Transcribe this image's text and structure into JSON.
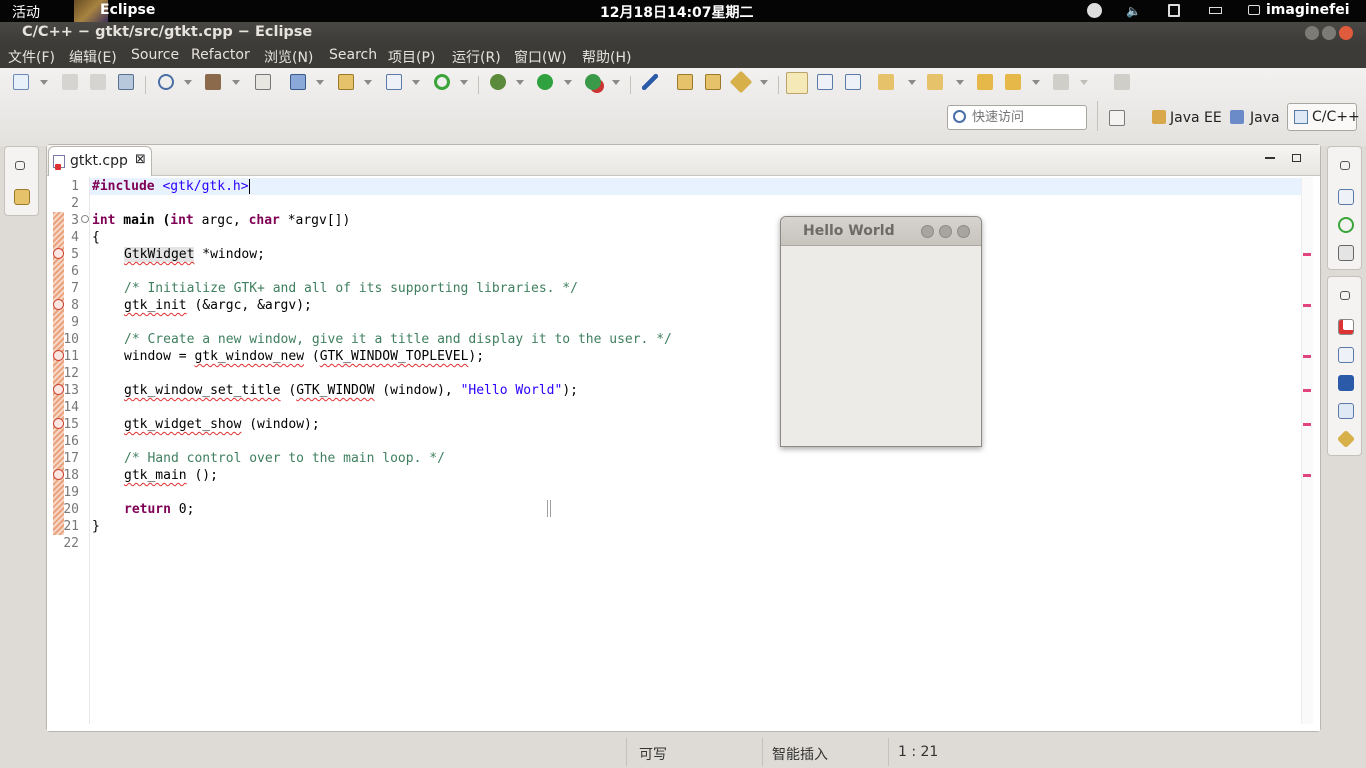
{
  "topbar": {
    "activities": "活动",
    "app_name": "Eclipse",
    "clock": "12月18日14:07星期二",
    "user": "imaginefei"
  },
  "window": {
    "title": "C/C++ − gtkt/src/gtkt.cpp − Eclipse"
  },
  "menu": [
    "文件(F)",
    "编辑(E)",
    "Source",
    "Refactor",
    "浏览(N)",
    "Search",
    "项目(P)",
    "运行(R)",
    "窗口(W)",
    "帮助(H)"
  ],
  "toolbar": {
    "quick_access_placeholder": "快速访问",
    "perspectives": [
      "Java EE",
      "Java",
      "C/C++"
    ],
    "active_perspective": "C/C++"
  },
  "editor": {
    "tab_label": "gtkt.cpp",
    "line_numbers": [
      "1",
      "2",
      "3",
      "4",
      "5",
      "6",
      "7",
      "8",
      "9",
      "10",
      "11",
      "12",
      "13",
      "14",
      "15",
      "16",
      "17",
      "18",
      "19",
      "20",
      "21",
      "22"
    ],
    "error_lines": [
      5,
      8,
      11,
      13,
      15,
      18
    ],
    "lines": {
      "l1_kw": "#include",
      "l1_inc": "<gtk/gtk.h>",
      "l3_kw": "int",
      "l3_a": " main (",
      "l3_kw2": "int",
      "l3_b": " argc, ",
      "l3_kw3": "char",
      "l3_c": " *argv[])",
      "l4": "{",
      "l5_err": "GtkWidget",
      "l5_rest": " *window;",
      "l7": "/* Initialize GTK+ and all of its supporting libraries. */",
      "l8_err": "gtk_init",
      "l8_rest": " (&argc, &argv);",
      "l10": "/* Create a new window, give it a title and display it to the user. */",
      "l11_a": "window = ",
      "l11_err": "gtk_window_new",
      "l11_b": " (",
      "l11_err2": "GTK_WINDOW_TOPLEVEL",
      "l11_c": ");",
      "l13_err": "gtk_window_set_title",
      "l13_a": " (",
      "l13_err2": "GTK_WINDOW",
      "l13_b": " (window), ",
      "l13_str": "\"Hello World\"",
      "l13_c": ");",
      "l15_err": "gtk_widget_show",
      "l15_rest": " (window);",
      "l17": "/* Hand control over to the main loop. */",
      "l18_err": "gtk_main",
      "l18_rest": " ();",
      "l20_kw": "return",
      "l20_rest": " 0;",
      "l21": "}"
    }
  },
  "hello_window": {
    "title": "Hello World"
  },
  "statusbar": {
    "writable": "可写",
    "insert_mode": "智能插入",
    "position": "1 : 21"
  },
  "colors": {
    "keyword": "#7f0055",
    "comment": "#3f7f5f",
    "string": "#2a00ff",
    "error_underline": "#e03030",
    "overview_error": "#e0457e"
  }
}
